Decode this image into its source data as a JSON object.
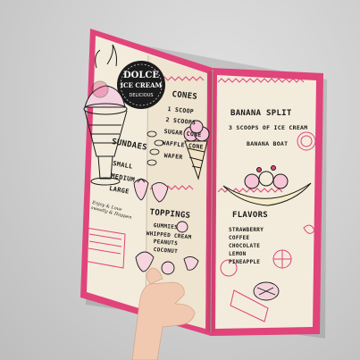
{
  "brand": {
    "line1": "DOLCE",
    "line2": "ICE CREAM",
    "tagline": "DELICIOUS"
  },
  "sections": {
    "sundaes": {
      "title": "SUNDAES",
      "items": [
        "SMALL",
        "MEDIUM",
        "LARGE"
      ]
    },
    "cones": {
      "title": "CONES",
      "items": [
        "1 SCOOP",
        "2 SCOOPS",
        "SUGAR CONE",
        "WAFFLE CONE",
        "WAFER"
      ]
    },
    "toppings": {
      "title": "TOPPINGS",
      "items": [
        "GUMMIES",
        "WHIPPED CREAM",
        "PEANUTS",
        "COCONUT"
      ]
    },
    "banana_split": {
      "title": "BANANA SPLIT",
      "items": [
        "3 SCOOPS OF ICE CREAM",
        "BANANA BOAT"
      ]
    },
    "flavors": {
      "title": "FLAVORS",
      "items": [
        "STRAWBERRY",
        "COFFEE",
        "CHOCOLATE",
        "LEMON",
        "PINEAPPLE"
      ]
    }
  },
  "signature": "Enjoy & Love sweetly & Happen",
  "colors": {
    "accent": "#e0447a",
    "paper": "#f3ecdc",
    "ink": "#1a1a1a",
    "background": "#cfcfcf",
    "skin": "#f1c9b0"
  }
}
